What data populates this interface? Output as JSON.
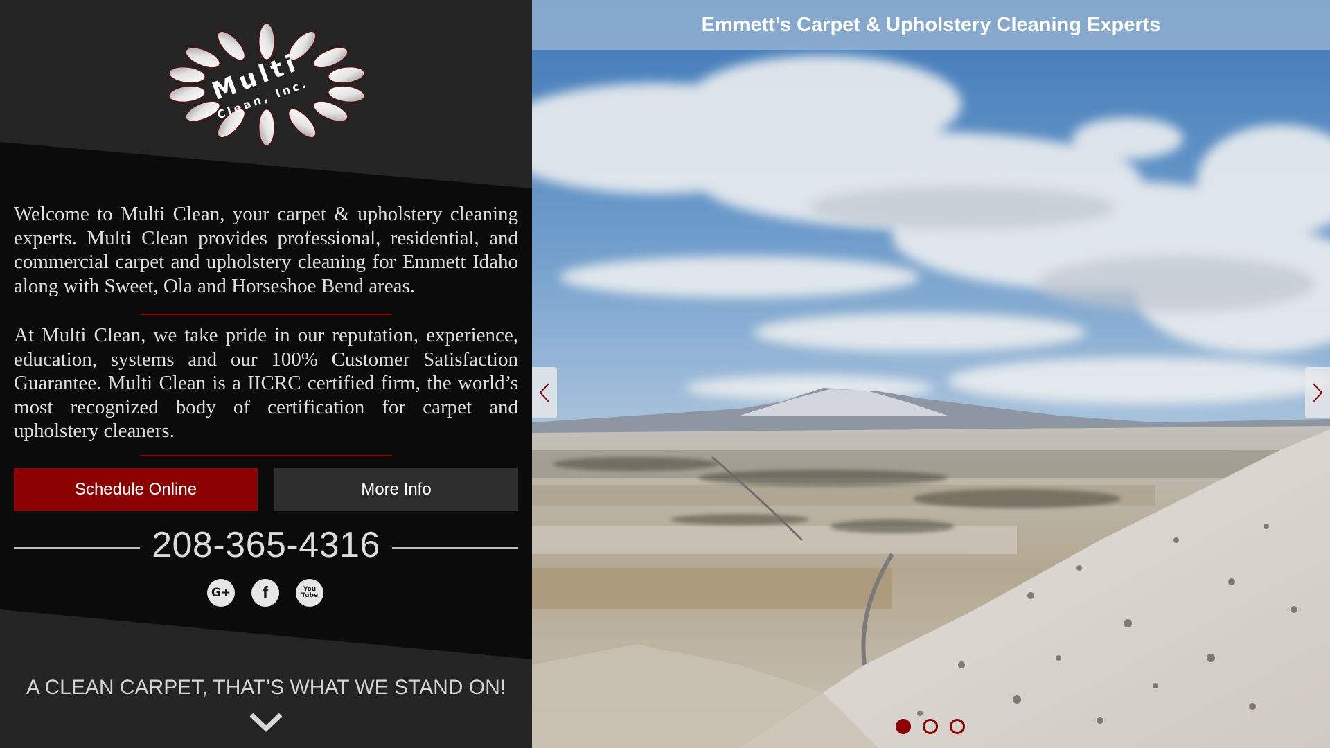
{
  "logo": {
    "name": "Multi",
    "subtitle": "Clean, Inc."
  },
  "intro": {
    "paragraph_1": "Welcome to Multi Clean, your carpet & upholstery cleaning experts. Multi Clean provides professional, residential, and commercial carpet and upholstery cleaning for Emmett Idaho along with Sweet, Ola and Horseshoe Bend areas.",
    "paragraph_2": "At Multi Clean, we take pride in our reputation, experience, education, systems and our 100% Customer Satisfaction Guarantee. Multi Clean is a IICRC certified firm, the world’s most recognized body of certification for carpet and upholstery cleaners."
  },
  "buttons": {
    "schedule_label": "Schedule Online",
    "more_info_label": "More Info"
  },
  "contact": {
    "phone": "208-365-4316"
  },
  "social": {
    "google": "G+",
    "facebook": "f",
    "youtube_top": "You",
    "youtube_bottom": "Tube",
    "icons": [
      "google-plus-icon",
      "facebook-icon",
      "youtube-icon"
    ]
  },
  "tagline": "A CLEAN CARPET, THAT’S WHAT WE STAND ON!",
  "slider": {
    "title": "Emmett’s Carpet & Upholstery Cleaning Experts",
    "slide_count": 3,
    "active_slide": 1
  },
  "colors": {
    "accent_red": "#8b0000",
    "panel_dark": "#0b0b0b",
    "panel_grey": "#242424",
    "text_light": "#dedede"
  }
}
